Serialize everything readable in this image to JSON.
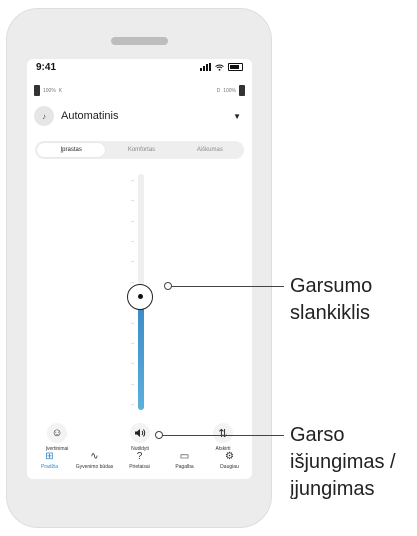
{
  "status_bar": {
    "time": "9:41"
  },
  "batteries": {
    "left": {
      "level_text": "100%",
      "side": "K"
    },
    "right": {
      "level_text": "100%",
      "side": "D"
    }
  },
  "program": {
    "name": "Automatinis",
    "icon": "sound-wave-icon"
  },
  "segments": {
    "items": [
      "Įprastas",
      "Komfortas",
      "Aiškumas"
    ],
    "selected": "Įprastas"
  },
  "volume_slider": {
    "level_fraction": 0.48,
    "tick_count": 12
  },
  "actions": {
    "rate_label": "Įvertinimai",
    "mute_label": "Nutildyti",
    "separate_label": "Atskirti"
  },
  "nav": {
    "items": [
      {
        "label": "Pradžia",
        "icon": "grid-icon",
        "active": true
      },
      {
        "label": "Gyvenimo būdas",
        "icon": "activity-icon",
        "active": false
      },
      {
        "label": "Prietaisai",
        "icon": "hearing-aid-icon",
        "active": false
      },
      {
        "label": "Pagalba",
        "icon": "chat-bubble-icon",
        "active": false
      },
      {
        "label": "Daugiau",
        "icon": "gear-icon",
        "active": false
      }
    ]
  },
  "colors": {
    "accent": "#2f86c8",
    "slider_fill": "#3a88c5"
  },
  "callouts": {
    "slider": {
      "line1": "Garsumo",
      "line2": "slankiklis"
    },
    "mute": {
      "line1": "Garso",
      "line2": "išjungimas /",
      "line3": "įjungimas"
    }
  }
}
